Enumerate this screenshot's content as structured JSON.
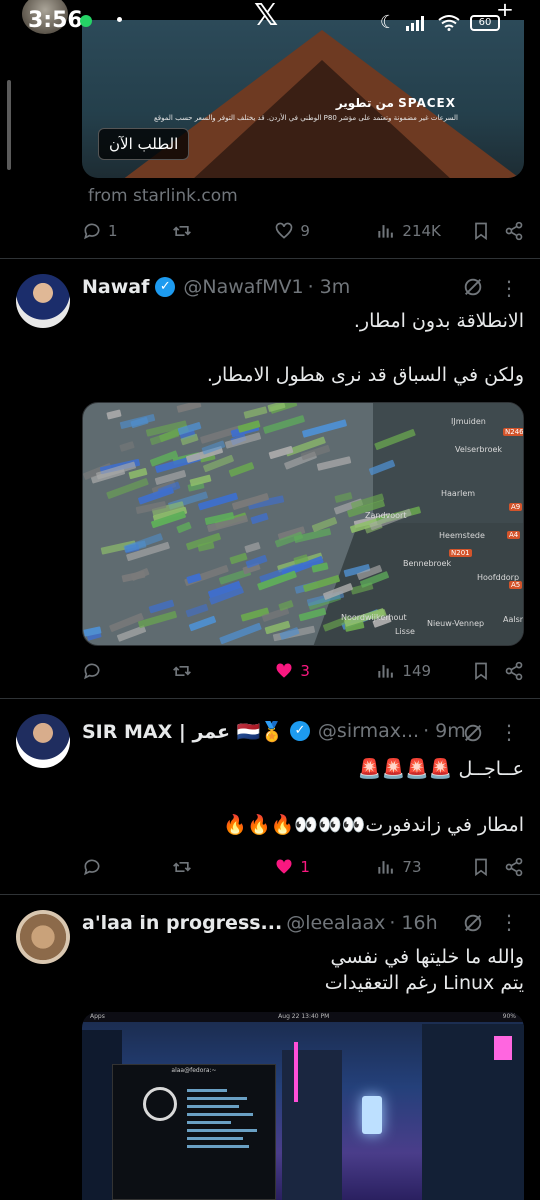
{
  "status_bar": {
    "time": "3:56",
    "app_logo": "𝕏",
    "battery": "60"
  },
  "ad": {
    "brand": "SPACEX",
    "brand_prefix": "من تطوير",
    "disclaimer": "السرعات غير مضمونة وتعتمد على مؤشر P80 الوطني في الأردن. قد يختلف التوفر والسعر حسب الموقع",
    "cta": "الطلب الآن",
    "from": "from starlink.com",
    "actions": {
      "replies": "1",
      "reposts": "",
      "likes": "9",
      "views": "214K"
    }
  },
  "tweets": [
    {
      "name": "Nawaf",
      "handle": "@NawafMV1",
      "time": "· 3m",
      "text_line1": "الانطلاقة بدون امطار.",
      "text_line2": "ولكن في السباق قد نرى هطول الامطار.",
      "map_labels": [
        "IJmuiden",
        "Velserbroek",
        "Haarlem",
        "Zandvoort",
        "Heemstede",
        "Bennebroek",
        "Hoofddorp",
        "Noordwijkerhout",
        "Lisse",
        "Nieuw-Vennep",
        "Aalsm"
      ],
      "map_roads": [
        "N246",
        "A9",
        "N201",
        "A4",
        "A5"
      ],
      "actions": {
        "replies": "",
        "reposts": "",
        "likes": "3",
        "views": "149",
        "liked": true
      }
    },
    {
      "name": "SIR MAX | عمر 🇳🇱🏅",
      "handle": "@sirmax...",
      "time": "· 9m",
      "text_line1": "عــاجــل 🚨🚨🚨🚨",
      "text_line2": "امطار في زاندفورت👀👀👀🔥🔥🔥",
      "actions": {
        "replies": "",
        "reposts": "",
        "likes": "1",
        "views": "73",
        "liked": true
      }
    },
    {
      "name": "a'laa in progress...",
      "handle": "@leealaax",
      "time": "· 16h",
      "text_line1": "والله ما خليتها في نفسي",
      "text_line2": "يتم Linux رغم التعقيدات",
      "screenshot": {
        "topbar_left": "Apps",
        "topbar_center": "Aug 22 13:40 PM",
        "topbar_right": "90%",
        "terminal_title": "alaa@fedora:~"
      }
    }
  ],
  "icons": [
    "whatsapp-icon",
    "x-logo-icon",
    "moon-icon",
    "signal-icon",
    "wifi-icon",
    "battery-icon",
    "add-account-icon",
    "reply-icon",
    "repost-icon",
    "like-icon",
    "views-icon",
    "bookmark-icon",
    "share-icon",
    "grok-icon",
    "more-icon",
    "verified-icon"
  ],
  "colors": {
    "background": "#000000",
    "text": "#e7e9ea",
    "muted": "#71767b",
    "verified": "#1d9bf0",
    "like": "#f91880",
    "divider": "#2f3336"
  }
}
